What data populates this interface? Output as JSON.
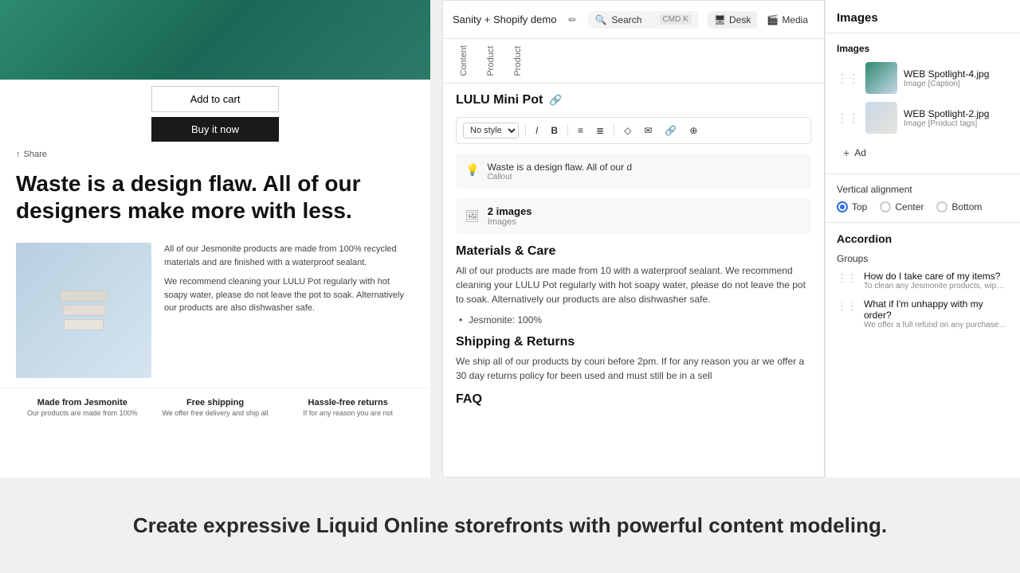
{
  "app": {
    "title": "Sanity + Shopify demo",
    "search_placeholder": "Search",
    "search_shortcut": "CMD K"
  },
  "view_tabs": [
    {
      "id": "desk",
      "label": "Desk",
      "active": true
    },
    {
      "id": "media",
      "label": "Media",
      "active": false
    }
  ],
  "editor": {
    "page_title": "LULU Mini Pot",
    "link_icon": "🔗",
    "toolbar": {
      "style_placeholder": "No style",
      "italic": "I",
      "bold": "B",
      "list_bullet": "≡",
      "list_number": "≡",
      "icons": [
        "◇",
        "✉",
        "🔗",
        "⊕"
      ]
    },
    "callout": {
      "icon": "💡",
      "text": "Waste is a design flaw. All of our d",
      "label": "Callout"
    },
    "images_block": {
      "icon": "🖼",
      "count": "2 images",
      "label": "Images"
    },
    "sections": [
      {
        "id": "materials",
        "title": "Materials & Care",
        "body": "All of our products are made from 10 with a waterproof sealant. We recommend cleaning your LULU Pot regularly with hot soapy water, please do not leave the pot to soak. Alternatively our products are also dishwasher safe.",
        "bullets": [
          "Jesmonite: 100%"
        ]
      },
      {
        "id": "shipping",
        "title": "Shipping & Returns",
        "body": "We ship all of our products by couri before 2pm. If for any reason you ar we offer a 30 day returns policy for been used and must still be in a sell"
      },
      {
        "id": "faq",
        "title": "FAQ",
        "is_faq": true
      }
    ]
  },
  "nav_tabs": [
    {
      "id": "content",
      "label": "Content"
    },
    {
      "id": "product1",
      "label": "Product"
    },
    {
      "id": "product2",
      "label": "Product"
    }
  ],
  "right_panel": {
    "header": "Images",
    "images_section": {
      "title": "Images",
      "items": [
        {
          "id": 1,
          "name": "WEB Spotlight-4.jpg",
          "tag": "Image [Caption]",
          "thumbnail_style": "spotlight4"
        },
        {
          "id": 2,
          "name": "WEB Spotlight-2.jpg",
          "tag": "Image [Product tags]",
          "thumbnail_style": "spotlight2"
        }
      ],
      "add_label": "Ad"
    },
    "vertical_alignment": {
      "title": "Vertical alignment",
      "options": [
        {
          "id": "top",
          "label": "Top",
          "selected": true
        },
        {
          "id": "center",
          "label": "Center",
          "selected": false
        },
        {
          "id": "bottom",
          "label": "Bottom",
          "selected": false
        }
      ]
    },
    "accordion": {
      "title": "Accordion",
      "groups_title": "Groups",
      "items": [
        {
          "id": 1,
          "title": "How do I take care of my items?",
          "preview": "To clean any Jesmonite products, wipe do"
        },
        {
          "id": 2,
          "title": "What if I'm unhappy with my order?",
          "preview": "We offer a full refund on any purchase with"
        }
      ]
    }
  },
  "preview": {
    "headline": "Waste is a design flaw. All of our designers make more with less.",
    "feature_texts": [
      "All of our Jesmonite products are made from 100% recycled materials and are finished with a waterproof sealant.",
      "We recommend cleaning your LULU Pot regularly with hot soapy water, please do not leave the pot to soak. Alternatively our products are also dishwasher safe."
    ],
    "buttons": {
      "add_to_cart": "Add to cart",
      "buy_it_now": "Buy it now"
    },
    "share": "Share",
    "bottom_features": [
      {
        "title": "Made from Jesmonite",
        "desc": "Our products are made from 100%"
      },
      {
        "title": "Free shipping",
        "desc": "We offer free delivery and ship all"
      },
      {
        "title": "Hassle-free returns",
        "desc": "If for any reason you are not"
      }
    ]
  },
  "bottom_tagline": "Create expressive Liquid Online storefronts with powerful content modeling."
}
